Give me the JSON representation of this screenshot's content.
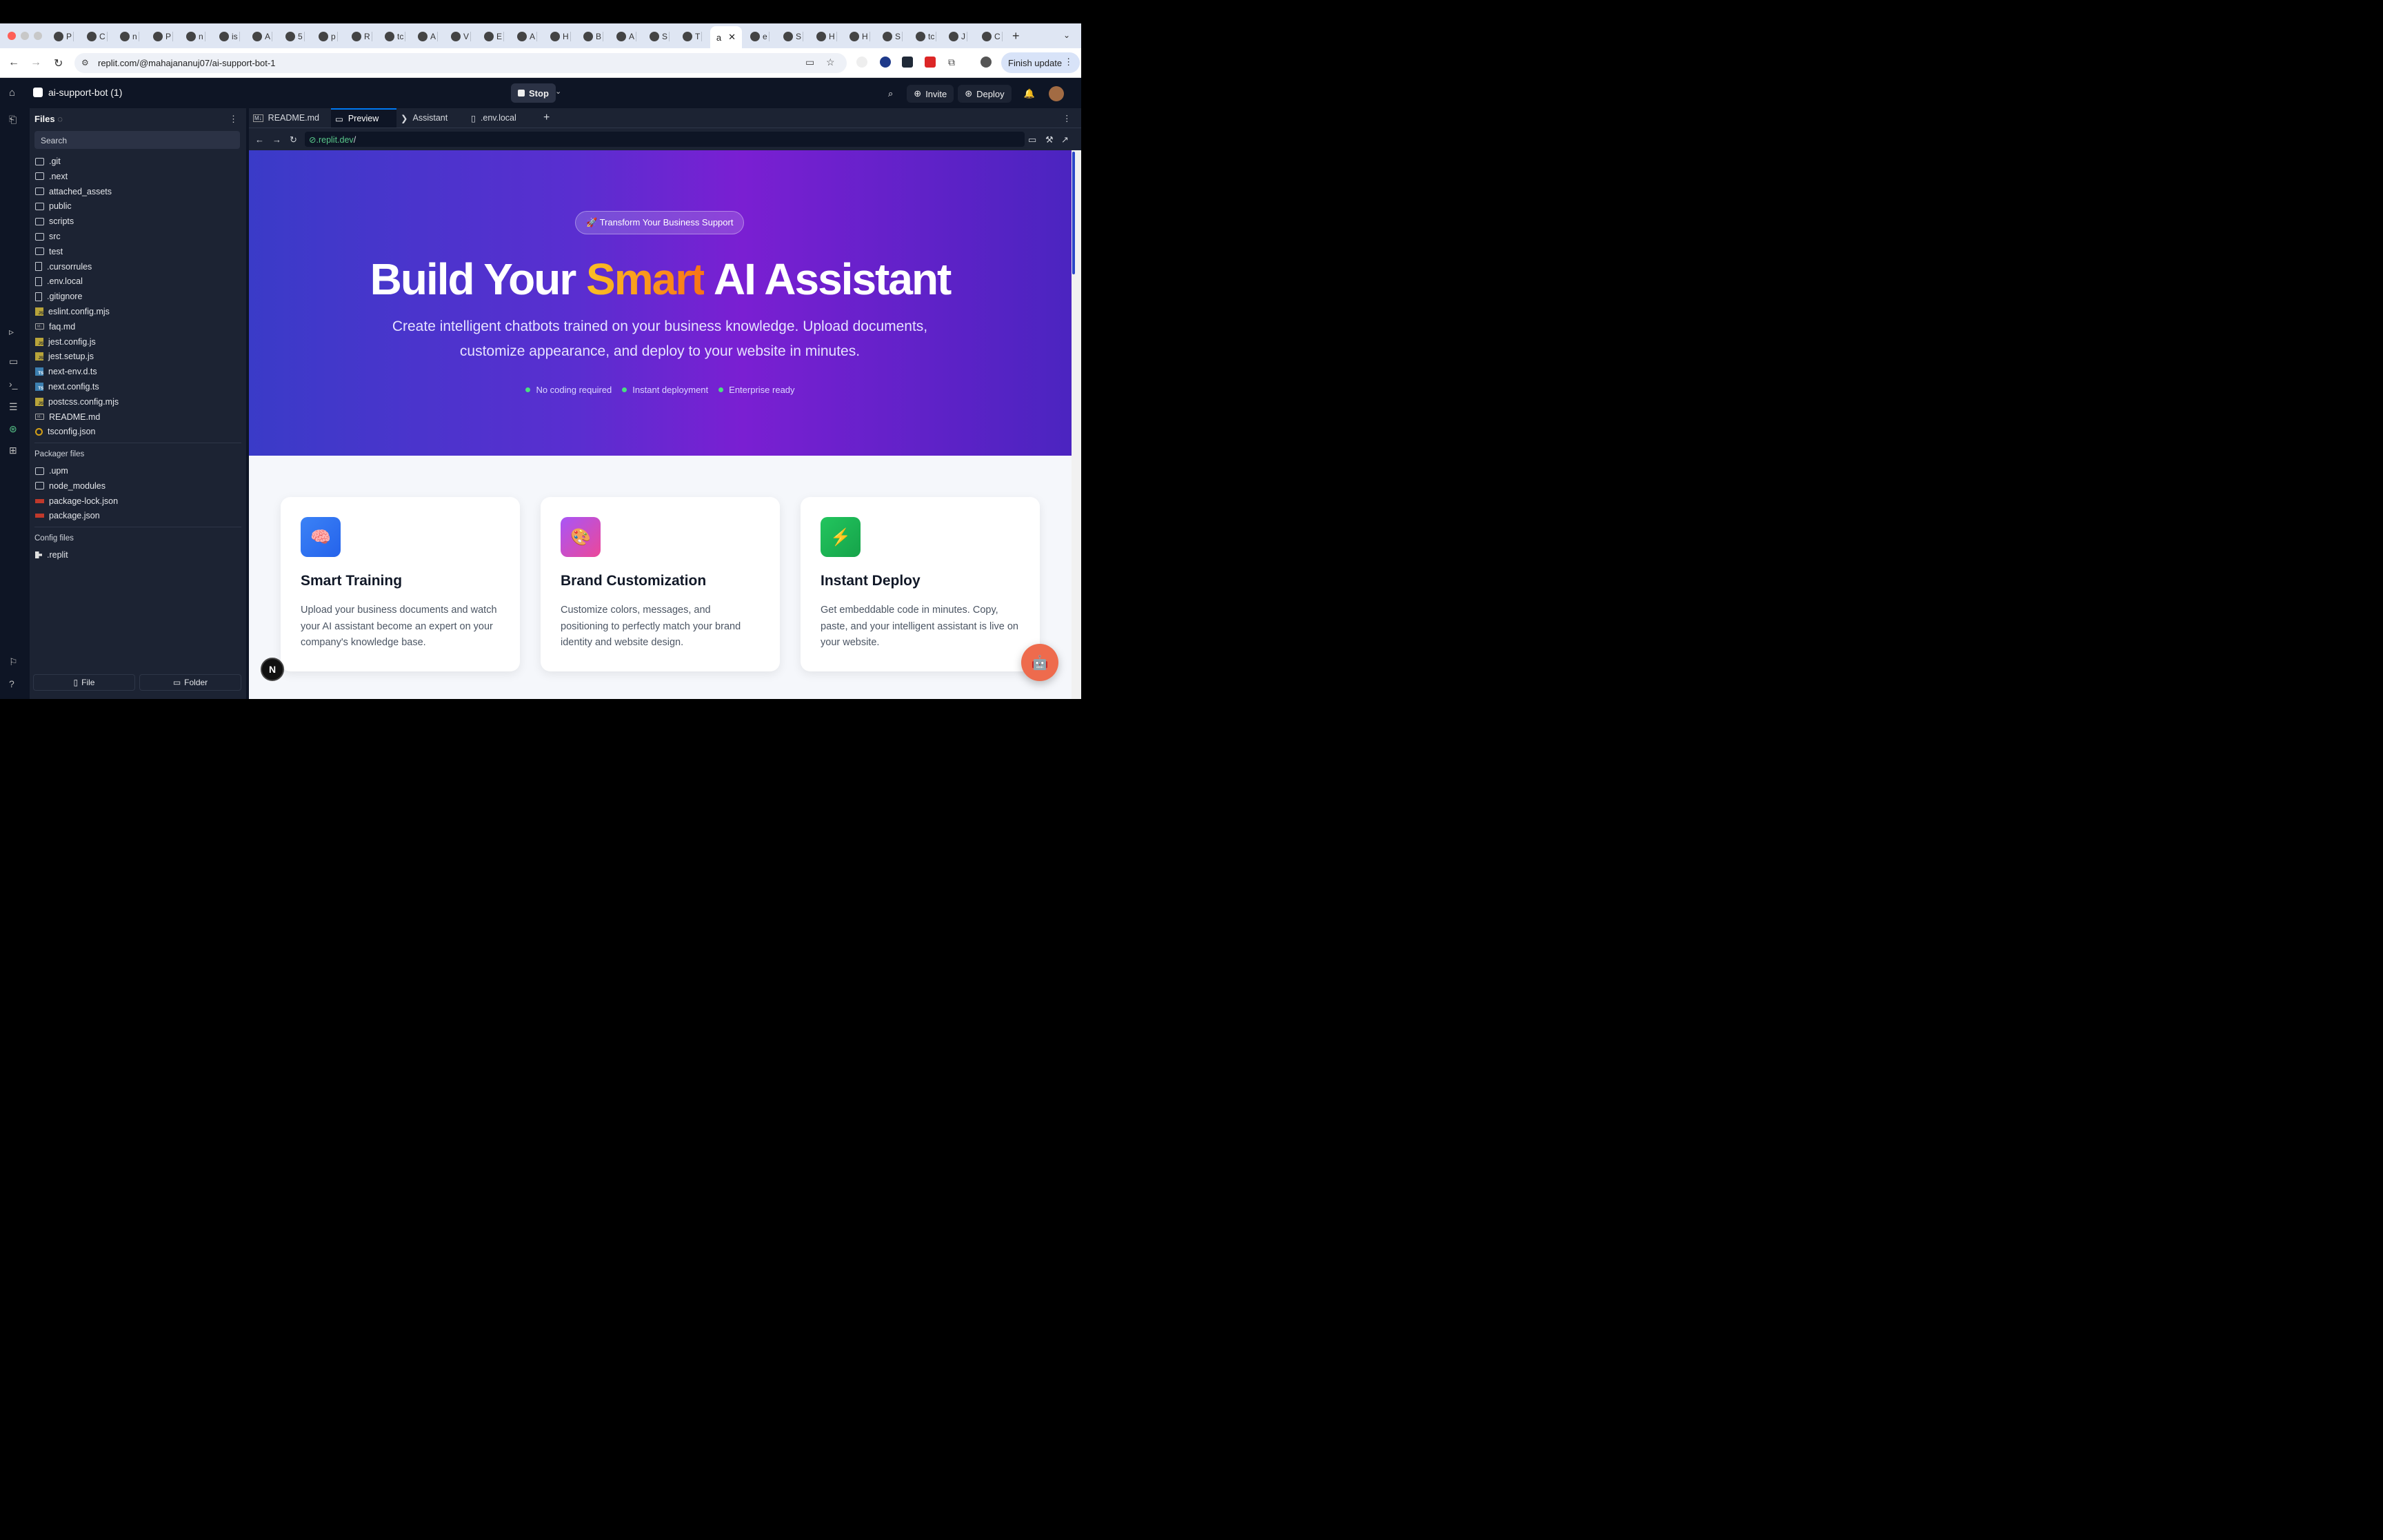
{
  "browser": {
    "tabs": [
      {
        "icon": "openai-icon",
        "label": "P"
      },
      {
        "icon": "google-icon",
        "label": "C"
      },
      {
        "icon": "google-icon",
        "label": "n"
      },
      {
        "icon": "link-icon",
        "label": "P"
      },
      {
        "icon": "link-icon",
        "label": "n"
      },
      {
        "icon": "github-icon",
        "label": "is"
      },
      {
        "icon": "triangle-icon",
        "label": "A"
      },
      {
        "icon": "w-icon",
        "label": "5"
      },
      {
        "icon": "google-icon",
        "label": "p"
      },
      {
        "icon": "openai-icon",
        "label": "R"
      },
      {
        "icon": "t-icon",
        "label": "tc"
      },
      {
        "icon": "triangle-icon",
        "label": "A"
      },
      {
        "icon": "triangle-icon",
        "label": "V"
      },
      {
        "icon": "outlook-icon",
        "label": "E"
      },
      {
        "icon": "app-icon",
        "label": "A"
      },
      {
        "icon": "check-icon",
        "label": "H"
      },
      {
        "icon": "drive-icon",
        "label": "B"
      },
      {
        "icon": "drive-icon",
        "label": "A"
      },
      {
        "icon": "library-icon",
        "label": "S"
      },
      {
        "icon": "openai-icon",
        "label": "T"
      }
    ],
    "active_tab_label": "a",
    "tabs_after": [
      {
        "icon": "google-icon",
        "label": "e"
      },
      {
        "icon": "s-icon",
        "label": "S"
      },
      {
        "icon": "dev-icon",
        "label": "H"
      },
      {
        "icon": "calendar-icon",
        "label": "H"
      },
      {
        "icon": "app-icon",
        "label": "S"
      },
      {
        "icon": "app-icon",
        "label": "tc"
      },
      {
        "icon": "openai-icon",
        "label": "J"
      },
      {
        "icon": "github-icon",
        "label": "C"
      }
    ],
    "url": "replit.com/@mahajananuj07/ai-support-bot-1",
    "finish_update": "Finish update"
  },
  "replit": {
    "project_name": "ai-support-bot (1)",
    "stop_label": "Stop",
    "invite_label": "Invite",
    "deploy_label": "Deploy"
  },
  "files": {
    "title": "Files",
    "search_placeholder": "Search",
    "items": [
      {
        "name": ".git",
        "type": "folder"
      },
      {
        "name": ".next",
        "type": "folder"
      },
      {
        "name": "attached_assets",
        "type": "folder"
      },
      {
        "name": "public",
        "type": "folder"
      },
      {
        "name": "scripts",
        "type": "folder"
      },
      {
        "name": "src",
        "type": "folder"
      },
      {
        "name": "test",
        "type": "folder"
      },
      {
        "name": ".cursorrules",
        "type": "file"
      },
      {
        "name": ".env.local",
        "type": "file"
      },
      {
        "name": ".gitignore",
        "type": "file"
      },
      {
        "name": "eslint.config.mjs",
        "type": "js"
      },
      {
        "name": "faq.md",
        "type": "md"
      },
      {
        "name": "jest.config.js",
        "type": "js"
      },
      {
        "name": "jest.setup.js",
        "type": "js"
      },
      {
        "name": "next-env.d.ts",
        "type": "ts"
      },
      {
        "name": "next.config.ts",
        "type": "ts"
      },
      {
        "name": "postcss.config.mjs",
        "type": "js"
      },
      {
        "name": "README.md",
        "type": "md"
      },
      {
        "name": "tsconfig.json",
        "type": "tsconfig"
      }
    ],
    "packager_label": "Packager files",
    "packager_items": [
      {
        "name": ".upm",
        "type": "folder"
      },
      {
        "name": "node_modules",
        "type": "folder"
      },
      {
        "name": "package-lock.json",
        "type": "pkg"
      },
      {
        "name": "package.json",
        "type": "pkg"
      }
    ],
    "config_label": "Config files",
    "config_items": [
      {
        "name": ".replit",
        "type": "replit"
      }
    ],
    "new_file_label": "File",
    "new_folder_label": "Folder"
  },
  "editor": {
    "tabs": [
      {
        "label": "README.md",
        "icon": "markdown-icon"
      },
      {
        "label": "Preview",
        "icon": "monitor-icon"
      },
      {
        "label": "Assistant",
        "icon": "assistant-icon"
      },
      {
        "label": ".env.local",
        "icon": "file-icon"
      }
    ],
    "preview_url_prefix": ".replit.dev",
    "preview_url_suffix": "/"
  },
  "page": {
    "badge": "🚀 Transform Your Business Support",
    "title_pre": "Build Your ",
    "title_accent": "Smart",
    "title_post": " AI Assistant",
    "subtitle": "Create intelligent chatbots trained on your business knowledge. Upload documents, customize appearance, and deploy to your website in minutes.",
    "features": [
      "No coding required",
      "Instant deployment",
      "Enterprise ready"
    ],
    "cards": [
      {
        "icon": "🧠",
        "title": "Smart Training",
        "desc": "Upload your business documents and watch your AI assistant become an expert on your company's knowledge base.",
        "color": "linear-gradient(135deg,#3b82f6,#2563eb)"
      },
      {
        "icon": "🎨",
        "title": "Brand Customization",
        "desc": "Customize colors, messages, and positioning to perfectly match your brand identity and website design.",
        "color": "linear-gradient(135deg,#a855f7,#ec4899)"
      },
      {
        "icon": "⚡",
        "title": "Instant Deploy",
        "desc": "Get embeddable code in minutes. Copy, paste, and your intelligent assistant is live on your website.",
        "color": "linear-gradient(135deg,#22c55e,#16a34a)"
      }
    ],
    "next_badge": "N",
    "chat_icon": "🤖"
  },
  "colors": {
    "replit_dark": "#0e1525",
    "replit_panel": "#1c2333",
    "accent_blue": "#0079f2",
    "hero_start": "#3a3bc8",
    "hero_end": "#7a1fd2",
    "title_accent": "#fbbf24",
    "chat_button": "#ee6b4d"
  }
}
